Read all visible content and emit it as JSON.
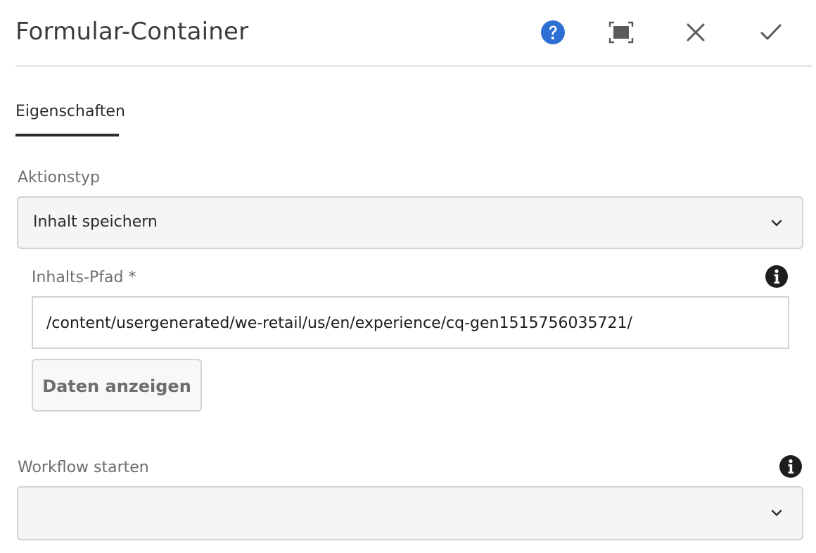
{
  "dialog": {
    "title": "Formular-Container",
    "actions": {
      "help_icon": "help-icon",
      "fullscreen_icon": "fullscreen-icon",
      "close_icon": "close-icon",
      "done_icon": "checkmark-icon"
    }
  },
  "tabs": [
    {
      "label": "Eigenschaften",
      "selected": true
    }
  ],
  "form": {
    "action_type": {
      "label": "Aktionstyp",
      "value": "Inhalt speichern"
    },
    "content_path": {
      "label": "Inhalts-Pfad *",
      "value": "/content/usergenerated/we-retail/us/en/experience/cq-gen1515756035721/"
    },
    "view_data_button": {
      "label": "Daten anzeigen"
    },
    "start_workflow": {
      "label": "Workflow starten",
      "value": ""
    }
  },
  "colors": {
    "help_blue": "#2d6fd3",
    "text_dark": "#2c2c2c",
    "label_gray": "#6e6e6e",
    "border": "#d3d3d3",
    "field_bg": "#f5f5f5"
  }
}
